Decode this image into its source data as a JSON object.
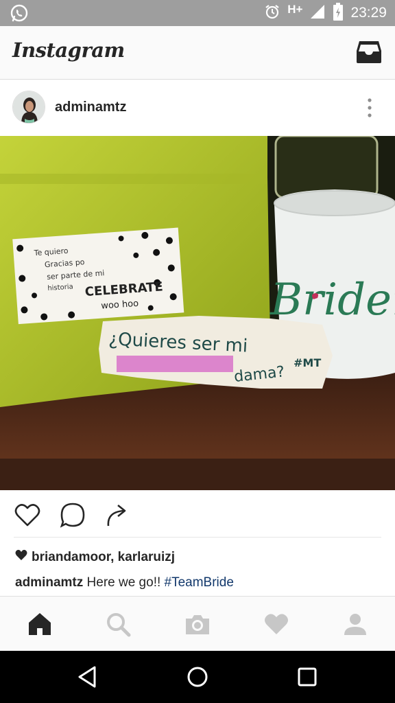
{
  "status_bar": {
    "time": "23:29",
    "network": "H+",
    "icons": [
      "whatsapp-icon",
      "alarm-icon",
      "signal-icon",
      "battery-icon"
    ]
  },
  "header": {
    "logo_text": "Instagram",
    "inbox_icon": "inbox-icon"
  },
  "post": {
    "username": "adminamtz",
    "photo_texts": {
      "card_line1": "Te quiero",
      "card_line2": "Gracias po",
      "card_line3": "ser parte de mi",
      "card_line4": "historia",
      "card_celebrate": "CELEBRATE",
      "card_woohoo": "woo hoo",
      "note_line1": "¿Quieres ser mi",
      "note_line2": "dama?",
      "note_tag": "#MT",
      "mug_text": "Briden"
    },
    "likes": "briandamoor, karlaruizj",
    "caption_user": "adminamtz",
    "caption_text": " Here we go!! ",
    "caption_hashtag": "#TeamBride"
  },
  "colors": {
    "status_bar": "#9e9e9e",
    "hashtag": "#12386b",
    "text": "#262626",
    "nav_active": "#262626",
    "nav_inactive": "#c7c7c7"
  },
  "bottom_nav": [
    "home-icon",
    "search-icon",
    "camera-icon",
    "activity-heart-icon",
    "profile-icon"
  ],
  "system_nav": [
    "back-icon",
    "home-circle-icon",
    "recents-icon"
  ]
}
